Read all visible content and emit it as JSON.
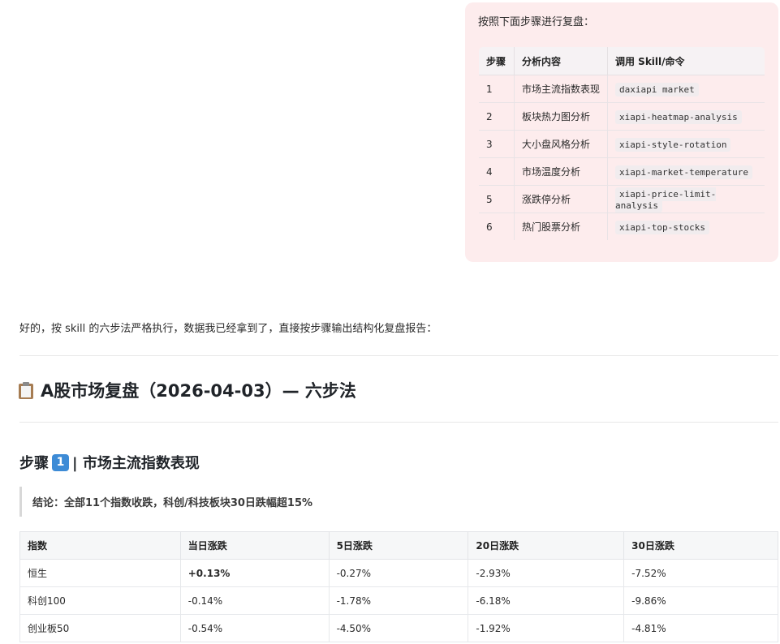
{
  "user_message": {
    "text": "按照下面步骤进行复盘：",
    "table": {
      "headers": [
        "步骤",
        "分析内容",
        "调用 Skill/命令"
      ],
      "rows": [
        {
          "step": "1",
          "content": "市场主流指数表现",
          "command": "daxiapi market"
        },
        {
          "step": "2",
          "content": "板块热力图分析",
          "command": "xiapi-heatmap-analysis"
        },
        {
          "step": "3",
          "content": "大小盘风格分析",
          "command": "xiapi-style-rotation"
        },
        {
          "step": "4",
          "content": "市场温度分析",
          "command": "xiapi-market-temperature"
        },
        {
          "step": "5",
          "content": "涨跌停分析",
          "command": "xiapi-price-limit-analysis"
        },
        {
          "step": "6",
          "content": "热门股票分析",
          "command": "xiapi-top-stocks"
        }
      ]
    }
  },
  "assistant": {
    "intro": "好的，按 skill 的六步法严格执行，数据我已经拿到了，直接按步骤输出结构化复盘报告：",
    "title": "A股市场复盘（2026-04-03）— 六步法",
    "step1": {
      "prefix": "步骤",
      "number": "1",
      "title": "| 市场主流指数表现",
      "conclusion": "结论：全部11个指数收跌，科创/科技板块30日跌幅超15%",
      "table": {
        "headers": [
          "指数",
          "当日涨跌",
          "5日涨跌",
          "20日涨跌",
          "30日涨跌"
        ],
        "rows": [
          [
            "恒生",
            "+0.13%",
            "-0.27%",
            "-2.93%",
            "-7.52%"
          ],
          [
            "科创100",
            "-0.14%",
            "-1.78%",
            "-6.18%",
            "-9.86%"
          ],
          [
            "创业板50",
            "-0.54%",
            "-4.50%",
            "-1.92%",
            "-4.81%"
          ]
        ]
      }
    }
  }
}
